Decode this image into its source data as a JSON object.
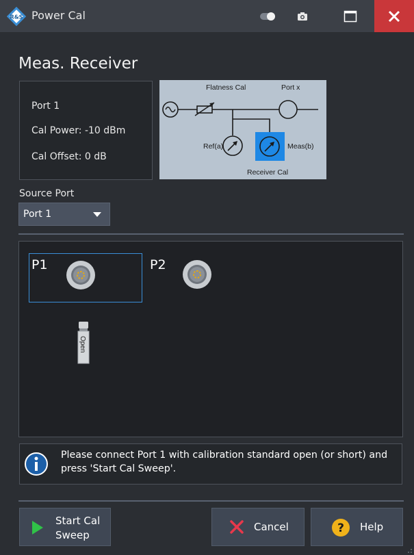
{
  "window": {
    "title": "Power Cal",
    "logo_text": "R&S",
    "controls": [
      "toggle-icon",
      "camera-icon",
      "maximize-icon",
      "close-icon"
    ]
  },
  "heading": "Meas. Receiver",
  "info": {
    "port": "Port 1",
    "cal_power": "Cal Power:  -10 dBm",
    "cal_offset": "Cal Offset:  0 dB"
  },
  "schematic": {
    "flatness_label": "Flatness Cal",
    "port_label": "Port x",
    "ref_label": "Ref(a)",
    "meas_label": "Meas(b)",
    "receiver_label": "Receiver Cal"
  },
  "source_port": {
    "label": "Source Port",
    "value": "Port 1"
  },
  "ports": {
    "p1": "P1",
    "p2": "P2",
    "standard": "Open"
  },
  "message": "Please connect Port 1 with calibration standard open (or short) and press 'Start Cal Sweep'.",
  "buttons": {
    "start_line1": "Start Cal",
    "start_line2": "Sweep",
    "cancel": "Cancel",
    "help": "Help"
  },
  "colors": {
    "accent": "#3a8fd8",
    "close": "#c9373a",
    "play": "#30c248",
    "cancel_x": "#e8384b",
    "help": "#f0b21a"
  }
}
